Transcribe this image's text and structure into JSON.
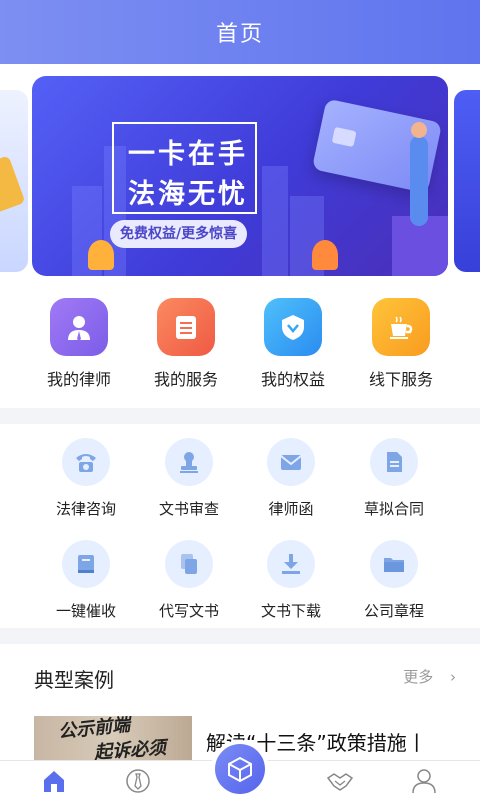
{
  "header": {
    "title": "首页"
  },
  "banner": {
    "line1": "一卡在手",
    "line2": "法海无忧",
    "pill": "免费权益/更多惊喜"
  },
  "quick_actions": [
    {
      "label": "我的律师",
      "icon": "lawyer-icon",
      "color": "#8f6cf0"
    },
    {
      "label": "我的服务",
      "icon": "service-list-icon",
      "color": "#f46f4f"
    },
    {
      "label": "我的权益",
      "icon": "badge-icon",
      "color": "#34a6f5"
    },
    {
      "label": "线下服务",
      "icon": "coffee-icon",
      "color": "#f9a72a"
    }
  ],
  "services": [
    {
      "label": "法律咨询",
      "icon": "phone-icon"
    },
    {
      "label": "文书审查",
      "icon": "stamp-icon"
    },
    {
      "label": "律师函",
      "icon": "envelope-icon"
    },
    {
      "label": "草拟合同",
      "icon": "document-icon"
    },
    {
      "label": "一键催收",
      "icon": "book-icon"
    },
    {
      "label": "代写文书",
      "icon": "copy-icon"
    },
    {
      "label": "文书下载",
      "icon": "download-icon"
    },
    {
      "label": "公司章程",
      "icon": "folder-icon"
    }
  ],
  "cases": {
    "heading": "典型案例",
    "more": "更多",
    "item": {
      "title": "解读“十三条”政策措施丨",
      "image_text_1": "公示前端",
      "image_text_2": "起诉必须"
    }
  },
  "tabbar": {
    "tabs": [
      {
        "icon": "home-icon"
      },
      {
        "icon": "tie-icon"
      },
      {
        "icon": "cube-icon"
      },
      {
        "icon": "handshake-icon"
      },
      {
        "icon": "user-icon"
      }
    ],
    "accent": "#5a6fee"
  }
}
